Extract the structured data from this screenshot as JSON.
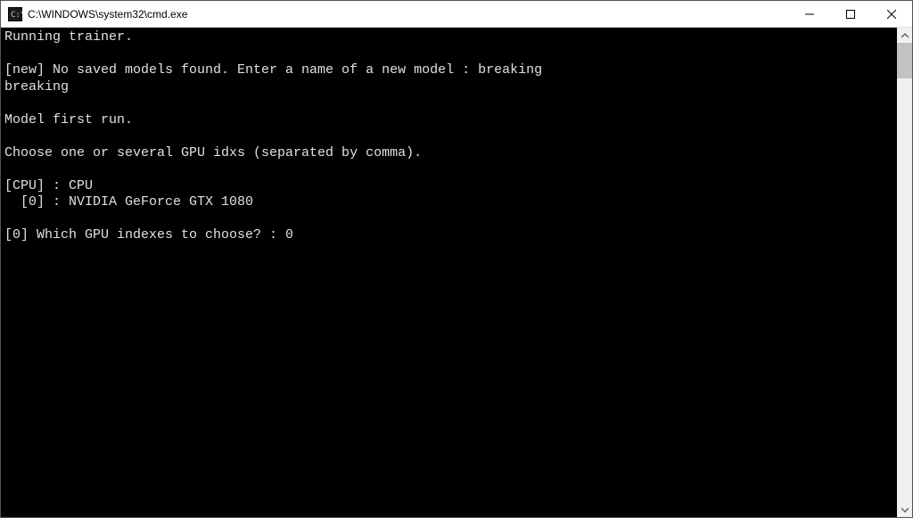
{
  "window": {
    "title": "C:\\WINDOWS\\system32\\cmd.exe"
  },
  "terminal": {
    "lines": [
      "Running trainer.",
      "",
      "[new] No saved models found. Enter a name of a new model : breaking",
      "breaking",
      "",
      "Model first run.",
      "",
      "Choose one or several GPU idxs (separated by comma).",
      "",
      "[CPU] : CPU",
      "  [0] : NVIDIA GeForce GTX 1080",
      "",
      "[0] Which GPU indexes to choose? : 0"
    ]
  }
}
